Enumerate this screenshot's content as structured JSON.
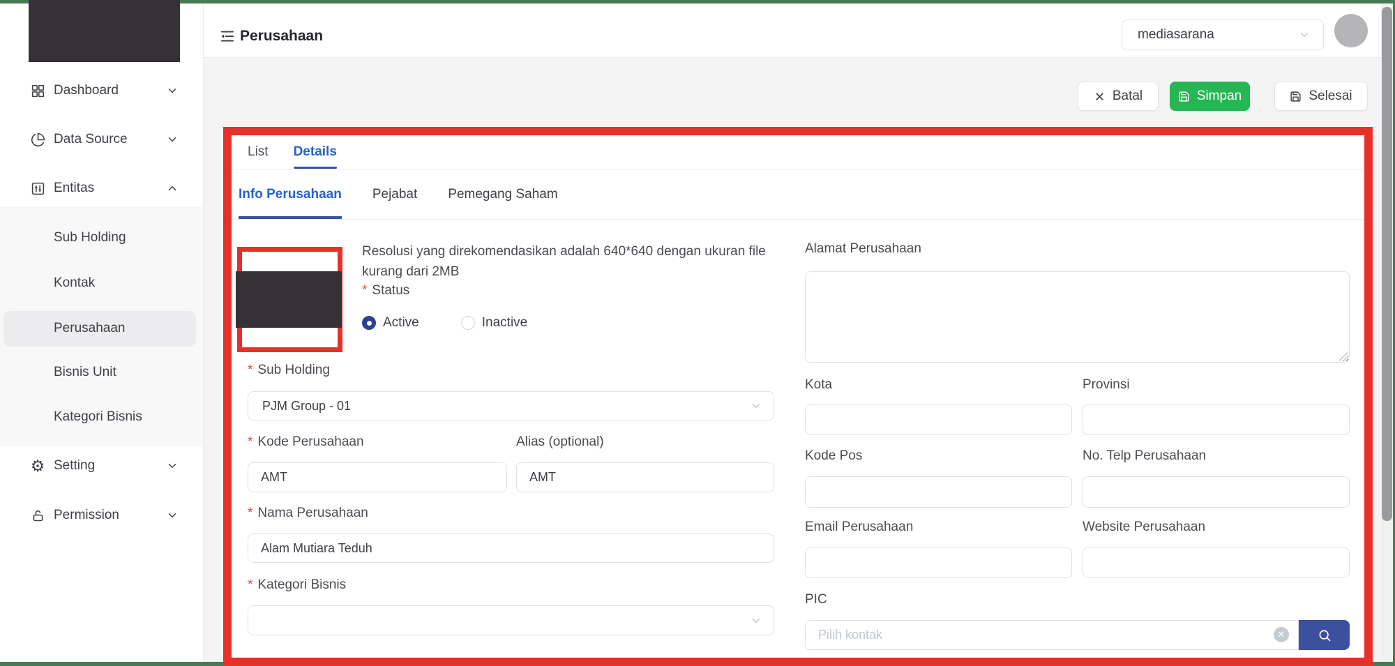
{
  "colors": {
    "frame_green": "#477a51",
    "annotation_red": "#e73128",
    "accent_navy": "#3a539f",
    "active_tab_blue": "#2563c9",
    "radio_navy": "#2c3f90",
    "simpan_green": "#26b653",
    "search_button_navy": "#3d4f9f"
  },
  "misc": {
    "required_marker": "*"
  },
  "icons": {
    "collapse": "menu-fold-icon",
    "grid": "grid-icon",
    "pie": "pie-chart-icon",
    "sliders": "sliders-icon",
    "gear": "gear-icon",
    "lock": "lock-icon",
    "close": "x-icon",
    "save": "floppy-icon",
    "search": "magnifier-icon",
    "clear": "circle-x-icon",
    "chevron": "chevron-icon"
  },
  "sidebar": {
    "items": [
      {
        "label": "Dashboard"
      },
      {
        "label": "Data Source"
      },
      {
        "label": "Entitas"
      },
      {
        "label": "Setting"
      },
      {
        "label": "Permission"
      }
    ],
    "submenu": {
      "items": [
        "Sub Holding",
        "Kontak",
        "Perusahaan",
        "Bisnis Unit",
        "Kategori Bisnis"
      ],
      "active": "Perusahaan"
    }
  },
  "header": {
    "title": "Perusahaan",
    "workspace_selector": "mediasarana"
  },
  "toolbar": {
    "batal": "Batal",
    "simpan": "Simpan",
    "selesai": "Selesai"
  },
  "tabs": {
    "items": [
      "List",
      "Details"
    ],
    "active": "Details"
  },
  "subtabs": {
    "items": [
      "Info Perusahaan",
      "Pejabat",
      "Pemegang Saham"
    ],
    "active": "Info Perusahaan"
  },
  "form": {
    "logo_hint_line1": "Resolusi yang direkomendasikan adalah 640*640 dengan ukuran file",
    "logo_hint_line2": "kurang dari 2MB",
    "status": {
      "label": "Status",
      "options": [
        "Active",
        "Inactive"
      ],
      "selected": "Active"
    },
    "sub_holding": {
      "label": "Sub Holding",
      "value": "PJM Group - 01"
    },
    "kode_perusahaan": {
      "label": "Kode Perusahaan",
      "value": "AMT"
    },
    "alias": {
      "label": "Alias (optional)",
      "value": "AMT"
    },
    "nama_perusahaan": {
      "label": "Nama Perusahaan",
      "value": "Alam Mutiara Teduh"
    },
    "kategori_bisnis": {
      "label": "Kategori Bisnis",
      "value": ""
    },
    "alamat": {
      "label": "Alamat Perusahaan",
      "value": ""
    },
    "kota": {
      "label": "Kota",
      "value": ""
    },
    "provinsi": {
      "label": "Provinsi",
      "value": ""
    },
    "kode_pos": {
      "label": "Kode Pos",
      "value": ""
    },
    "telp": {
      "label": "No. Telp Perusahaan",
      "value": ""
    },
    "email": {
      "label": "Email Perusahaan",
      "value": ""
    },
    "website": {
      "label": "Website Perusahaan",
      "value": ""
    },
    "pic": {
      "label": "PIC",
      "placeholder": "Pilih kontak"
    }
  }
}
